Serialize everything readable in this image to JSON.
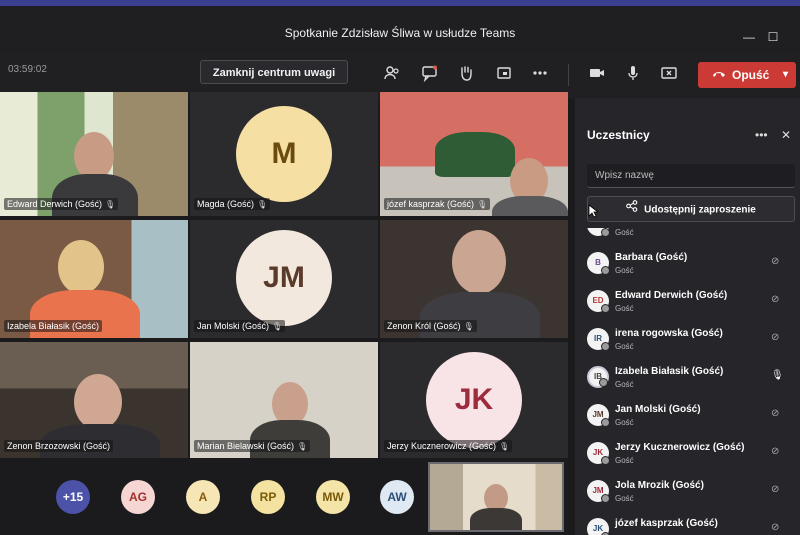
{
  "window": {
    "title": "Spotkanie Zdzisław Śliwa w usłudze Teams",
    "minimize_glyph": "—",
    "maximize_glyph": "☐"
  },
  "toolbar": {
    "timer": "03:59:02",
    "focus_button": "Zamknij centrum uwagi",
    "icons": [
      "people-icon",
      "chat-icon",
      "raise-hand-icon",
      "share-tray-icon",
      "more-icon",
      "camera-icon",
      "microphone-icon",
      "share-screen-icon"
    ],
    "leave_label": "Opuść",
    "leave_color": "#cc3a36",
    "accent": "#7b83eb"
  },
  "grid": {
    "tiles": [
      {
        "name": "Edward Derwich (Gość)"
      },
      {
        "name": "Magda (Gość)",
        "initials": "M",
        "avatar_bg": "#f5dfa3",
        "avatar_fg": "#6b4a10"
      },
      {
        "name": "józef kasprzak (Gość)"
      },
      {
        "name": "Izabela Białasik (Gość)"
      },
      {
        "name": "Jan Molski (Gość)",
        "initials": "JM",
        "avatar_bg": "#f3e8de",
        "avatar_fg": "#5a3a2a"
      },
      {
        "name": "Zenon Król (Gość)"
      },
      {
        "name": "Zenon Brzozowski (Gość)"
      },
      {
        "name": "Marian Bielawski (Gość)"
      },
      {
        "name": "Jerzy Kucznerowicz (Gość)",
        "initials": "JK",
        "avatar_bg": "#f8e3e6",
        "avatar_fg": "#9c2b3b"
      }
    ]
  },
  "bottom_avatars": [
    {
      "label": "+15",
      "bg": "#4b52a8",
      "fg": "#ffffff"
    },
    {
      "label": "AG",
      "bg": "#f6d6d2",
      "fg": "#a3302a"
    },
    {
      "label": "A",
      "bg": "#f7e6b5",
      "fg": "#8a5a0a"
    },
    {
      "label": "RP",
      "bg": "#f4e2a0",
      "fg": "#7a5a08"
    },
    {
      "label": "MW",
      "bg": "#f5e4a8",
      "fg": "#7a5a08"
    },
    {
      "label": "AW",
      "bg": "#dfe9f3",
      "fg": "#2c4f78"
    }
  ],
  "panel": {
    "title": "Uczestnicy",
    "more": "•••",
    "close": "✕",
    "search_placeholder": "Wpisz nazwę",
    "share_label": "Udostępnij zaproszenie",
    "participants": [
      {
        "initials": "",
        "name": "",
        "sub": "Gość"
      },
      {
        "initials": "B",
        "name": "Barbara (Gość)",
        "sub": "Gość"
      },
      {
        "initials": "ED",
        "name": "Edward Derwich (Gość)",
        "sub": "Gość"
      },
      {
        "initials": "IR",
        "name": "irena rogowska (Gość)",
        "sub": "Gość"
      },
      {
        "initials": "IB",
        "name": "Izabela Białasik (Gość)",
        "sub": "Gość"
      },
      {
        "initials": "JM",
        "name": "Jan Molski (Gość)",
        "sub": "Gość"
      },
      {
        "initials": "JK",
        "name": "Jerzy Kucznerowicz (Gość)",
        "sub": "Gość"
      },
      {
        "initials": "JM",
        "name": "Jola Mrozik (Gość)",
        "sub": "Gość"
      },
      {
        "initials": "JK",
        "name": "józef kasprzak (Gość)",
        "sub": ""
      }
    ]
  }
}
